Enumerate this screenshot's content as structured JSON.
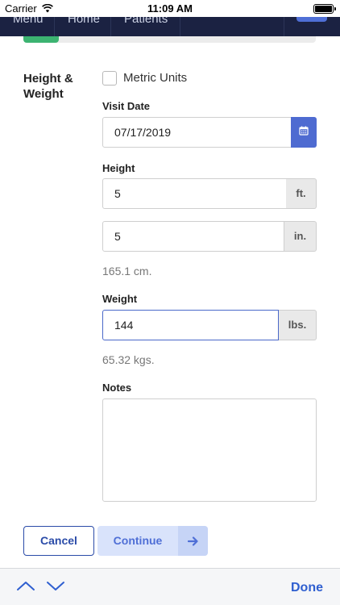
{
  "status_bar": {
    "carrier": "Carrier",
    "time": "11:09 AM"
  },
  "nav": {
    "menu": "Menu",
    "home": "Home",
    "patients": "Patients"
  },
  "progress": {
    "fraction": 0.12,
    "color": "#3cb371"
  },
  "section": {
    "title": "Height & Weight"
  },
  "metric": {
    "label": "Metric Units",
    "checked": false
  },
  "visit_date": {
    "label": "Visit Date",
    "value": "07/17/2019"
  },
  "height": {
    "label": "Height",
    "feet": "5",
    "feet_unit": "ft.",
    "inches": "5",
    "inches_unit": "in.",
    "converted": "165.1 cm."
  },
  "weight": {
    "label": "Weight",
    "value": "144",
    "unit": "lbs.",
    "converted": "65.32 kgs."
  },
  "notes": {
    "label": "Notes",
    "value": ""
  },
  "actions": {
    "cancel": "Cancel",
    "continue": "Continue"
  },
  "accessory": {
    "done": "Done"
  },
  "colors": {
    "accent": "#4e6bd1",
    "nav_bg": "#1b2242",
    "primary_text": "#2a4ba8"
  }
}
